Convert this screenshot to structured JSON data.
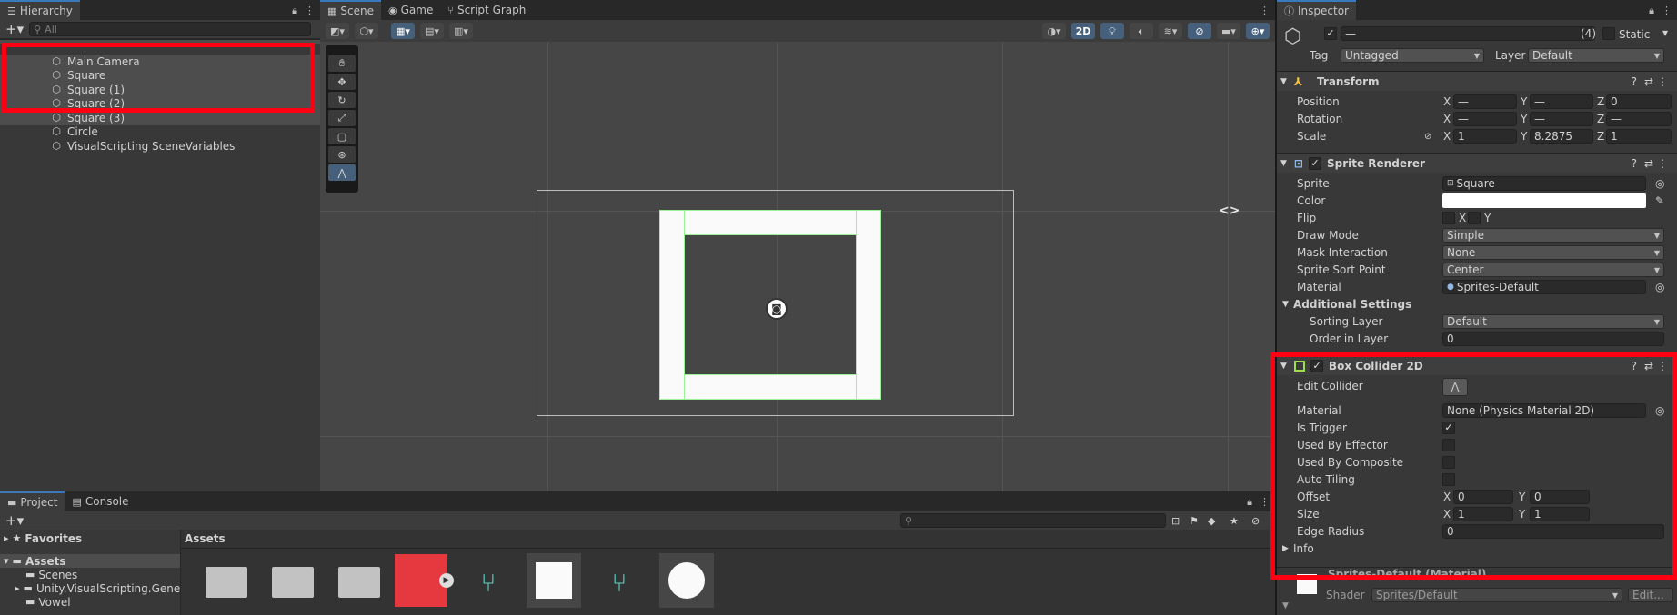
{
  "hierarchy": {
    "tab_label": "Hierarchy",
    "search_placeholder": "All",
    "items": [
      {
        "label": "Main Camera"
      },
      {
        "label": "Square"
      },
      {
        "label": "Square (1)"
      },
      {
        "label": "Square (2)"
      },
      {
        "label": "Square (3)"
      },
      {
        "label": "Circle"
      },
      {
        "label": "VisualScripting SceneVariables"
      }
    ]
  },
  "scene": {
    "tabs": [
      {
        "label": "Scene"
      },
      {
        "label": "Game"
      },
      {
        "label": "Script Graph"
      }
    ],
    "toolbar_2d_label": "2D"
  },
  "project": {
    "tabs": [
      {
        "label": "Project"
      },
      {
        "label": "Console"
      }
    ],
    "tree": [
      {
        "label": "Favorites"
      },
      {
        "label": "Assets"
      },
      {
        "label": "Scenes"
      },
      {
        "label": "Unity.VisualScripting.Genera"
      },
      {
        "label": "Vowel"
      }
    ],
    "assets_header": "Assets"
  },
  "inspector": {
    "tab_label": "Inspector",
    "object_name": "—",
    "count": "(4)",
    "static_label": "Static",
    "tag_label": "Tag",
    "tag_value": "Untagged",
    "layer_label": "Layer",
    "layer_value": "Default",
    "transform": {
      "title": "Transform",
      "position_label": "Position",
      "rotation_label": "Rotation",
      "scale_label": "Scale",
      "pos_x": "—",
      "pos_y": "—",
      "pos_z": "0",
      "rot_x": "—",
      "rot_y": "—",
      "rot_z": "—",
      "scale_x": "1",
      "scale_y": "8.2875",
      "scale_z": "1"
    },
    "sprite_renderer": {
      "title": "Sprite Renderer",
      "sprite_label": "Sprite",
      "sprite_value": "Square",
      "color_label": "Color",
      "flip_label": "Flip",
      "draw_mode_label": "Draw Mode",
      "draw_mode_value": "Simple",
      "mask_label": "Mask Interaction",
      "mask_value": "None",
      "sort_point_label": "Sprite Sort Point",
      "sort_point_value": "Center",
      "material_label": "Material",
      "material_value": "Sprites-Default",
      "additional_label": "Additional Settings",
      "sorting_layer_label": "Sorting Layer",
      "sorting_layer_value": "Default",
      "order_label": "Order in Layer",
      "order_value": "0"
    },
    "box_collider": {
      "title": "Box Collider 2D",
      "edit_label": "Edit Collider",
      "material_label": "Material",
      "material_value": "None (Physics Material 2D)",
      "trigger_label": "Is Trigger",
      "effector_label": "Used By Effector",
      "composite_label": "Used By Composite",
      "tiling_label": "Auto Tiling",
      "offset_label": "Offset",
      "offset_x": "0",
      "offset_y": "0",
      "size_label": "Size",
      "size_x": "1",
      "size_y": "1",
      "edge_label": "Edge Radius",
      "edge_value": "0",
      "info_label": "Info"
    },
    "material_footer": {
      "name": "Sprites-Default (Material)",
      "shader_label": "Shader",
      "shader_value": "Sprites/Default",
      "edit_label": "Edit..."
    }
  },
  "colors": {
    "highlight": "#ff0012",
    "accent": "#3a79bb",
    "selection_outline": "#9cf29a"
  }
}
